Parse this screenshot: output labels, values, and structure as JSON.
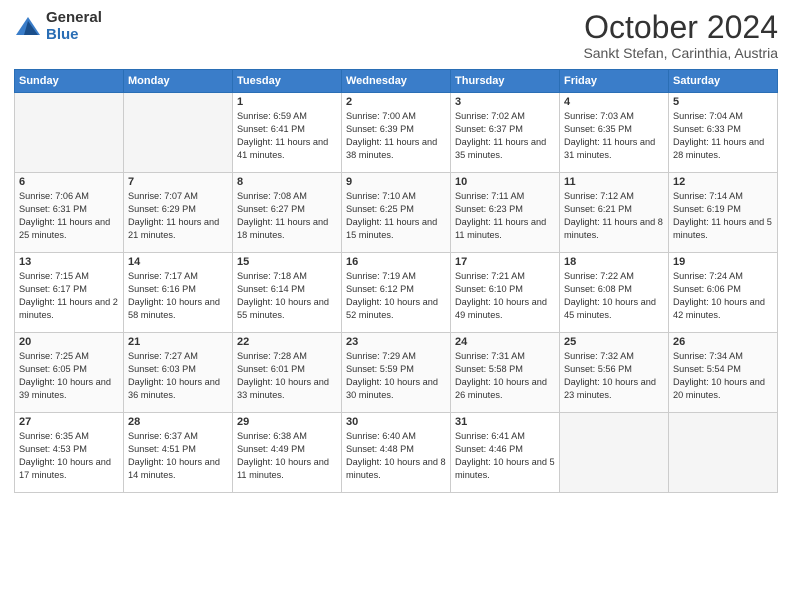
{
  "logo": {
    "general": "General",
    "blue": "Blue"
  },
  "header": {
    "month": "October 2024",
    "location": "Sankt Stefan, Carinthia, Austria"
  },
  "days_of_week": [
    "Sunday",
    "Monday",
    "Tuesday",
    "Wednesday",
    "Thursday",
    "Friday",
    "Saturday"
  ],
  "weeks": [
    [
      {
        "day": "",
        "empty": true
      },
      {
        "day": "",
        "empty": true
      },
      {
        "day": "1",
        "sunrise": "Sunrise: 6:59 AM",
        "sunset": "Sunset: 6:41 PM",
        "daylight": "Daylight: 11 hours and 41 minutes."
      },
      {
        "day": "2",
        "sunrise": "Sunrise: 7:00 AM",
        "sunset": "Sunset: 6:39 PM",
        "daylight": "Daylight: 11 hours and 38 minutes."
      },
      {
        "day": "3",
        "sunrise": "Sunrise: 7:02 AM",
        "sunset": "Sunset: 6:37 PM",
        "daylight": "Daylight: 11 hours and 35 minutes."
      },
      {
        "day": "4",
        "sunrise": "Sunrise: 7:03 AM",
        "sunset": "Sunset: 6:35 PM",
        "daylight": "Daylight: 11 hours and 31 minutes."
      },
      {
        "day": "5",
        "sunrise": "Sunrise: 7:04 AM",
        "sunset": "Sunset: 6:33 PM",
        "daylight": "Daylight: 11 hours and 28 minutes."
      }
    ],
    [
      {
        "day": "6",
        "sunrise": "Sunrise: 7:06 AM",
        "sunset": "Sunset: 6:31 PM",
        "daylight": "Daylight: 11 hours and 25 minutes."
      },
      {
        "day": "7",
        "sunrise": "Sunrise: 7:07 AM",
        "sunset": "Sunset: 6:29 PM",
        "daylight": "Daylight: 11 hours and 21 minutes."
      },
      {
        "day": "8",
        "sunrise": "Sunrise: 7:08 AM",
        "sunset": "Sunset: 6:27 PM",
        "daylight": "Daylight: 11 hours and 18 minutes."
      },
      {
        "day": "9",
        "sunrise": "Sunrise: 7:10 AM",
        "sunset": "Sunset: 6:25 PM",
        "daylight": "Daylight: 11 hours and 15 minutes."
      },
      {
        "day": "10",
        "sunrise": "Sunrise: 7:11 AM",
        "sunset": "Sunset: 6:23 PM",
        "daylight": "Daylight: 11 hours and 11 minutes."
      },
      {
        "day": "11",
        "sunrise": "Sunrise: 7:12 AM",
        "sunset": "Sunset: 6:21 PM",
        "daylight": "Daylight: 11 hours and 8 minutes."
      },
      {
        "day": "12",
        "sunrise": "Sunrise: 7:14 AM",
        "sunset": "Sunset: 6:19 PM",
        "daylight": "Daylight: 11 hours and 5 minutes."
      }
    ],
    [
      {
        "day": "13",
        "sunrise": "Sunrise: 7:15 AM",
        "sunset": "Sunset: 6:17 PM",
        "daylight": "Daylight: 11 hours and 2 minutes."
      },
      {
        "day": "14",
        "sunrise": "Sunrise: 7:17 AM",
        "sunset": "Sunset: 6:16 PM",
        "daylight": "Daylight: 10 hours and 58 minutes."
      },
      {
        "day": "15",
        "sunrise": "Sunrise: 7:18 AM",
        "sunset": "Sunset: 6:14 PM",
        "daylight": "Daylight: 10 hours and 55 minutes."
      },
      {
        "day": "16",
        "sunrise": "Sunrise: 7:19 AM",
        "sunset": "Sunset: 6:12 PM",
        "daylight": "Daylight: 10 hours and 52 minutes."
      },
      {
        "day": "17",
        "sunrise": "Sunrise: 7:21 AM",
        "sunset": "Sunset: 6:10 PM",
        "daylight": "Daylight: 10 hours and 49 minutes."
      },
      {
        "day": "18",
        "sunrise": "Sunrise: 7:22 AM",
        "sunset": "Sunset: 6:08 PM",
        "daylight": "Daylight: 10 hours and 45 minutes."
      },
      {
        "day": "19",
        "sunrise": "Sunrise: 7:24 AM",
        "sunset": "Sunset: 6:06 PM",
        "daylight": "Daylight: 10 hours and 42 minutes."
      }
    ],
    [
      {
        "day": "20",
        "sunrise": "Sunrise: 7:25 AM",
        "sunset": "Sunset: 6:05 PM",
        "daylight": "Daylight: 10 hours and 39 minutes."
      },
      {
        "day": "21",
        "sunrise": "Sunrise: 7:27 AM",
        "sunset": "Sunset: 6:03 PM",
        "daylight": "Daylight: 10 hours and 36 minutes."
      },
      {
        "day": "22",
        "sunrise": "Sunrise: 7:28 AM",
        "sunset": "Sunset: 6:01 PM",
        "daylight": "Daylight: 10 hours and 33 minutes."
      },
      {
        "day": "23",
        "sunrise": "Sunrise: 7:29 AM",
        "sunset": "Sunset: 5:59 PM",
        "daylight": "Daylight: 10 hours and 30 minutes."
      },
      {
        "day": "24",
        "sunrise": "Sunrise: 7:31 AM",
        "sunset": "Sunset: 5:58 PM",
        "daylight": "Daylight: 10 hours and 26 minutes."
      },
      {
        "day": "25",
        "sunrise": "Sunrise: 7:32 AM",
        "sunset": "Sunset: 5:56 PM",
        "daylight": "Daylight: 10 hours and 23 minutes."
      },
      {
        "day": "26",
        "sunrise": "Sunrise: 7:34 AM",
        "sunset": "Sunset: 5:54 PM",
        "daylight": "Daylight: 10 hours and 20 minutes."
      }
    ],
    [
      {
        "day": "27",
        "sunrise": "Sunrise: 6:35 AM",
        "sunset": "Sunset: 4:53 PM",
        "daylight": "Daylight: 10 hours and 17 minutes."
      },
      {
        "day": "28",
        "sunrise": "Sunrise: 6:37 AM",
        "sunset": "Sunset: 4:51 PM",
        "daylight": "Daylight: 10 hours and 14 minutes."
      },
      {
        "day": "29",
        "sunrise": "Sunrise: 6:38 AM",
        "sunset": "Sunset: 4:49 PM",
        "daylight": "Daylight: 10 hours and 11 minutes."
      },
      {
        "day": "30",
        "sunrise": "Sunrise: 6:40 AM",
        "sunset": "Sunset: 4:48 PM",
        "daylight": "Daylight: 10 hours and 8 minutes."
      },
      {
        "day": "31",
        "sunrise": "Sunrise: 6:41 AM",
        "sunset": "Sunset: 4:46 PM",
        "daylight": "Daylight: 10 hours and 5 minutes."
      },
      {
        "day": "",
        "empty": true
      },
      {
        "day": "",
        "empty": true
      }
    ]
  ]
}
